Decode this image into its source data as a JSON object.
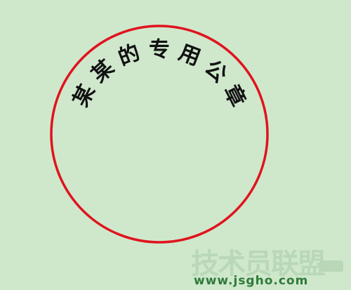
{
  "background_color": "#cfe8cc",
  "seal": {
    "ring_color": "#e0141e",
    "text_color": "#111111",
    "characters": [
      "某",
      "某",
      "的",
      "专",
      "用",
      "公",
      "章"
    ]
  },
  "watermark": {
    "title": "技术员联盟",
    "url": "www.jsgho.com",
    "title_color": "#b9d8b8",
    "url_color": "#2f7a3a"
  }
}
